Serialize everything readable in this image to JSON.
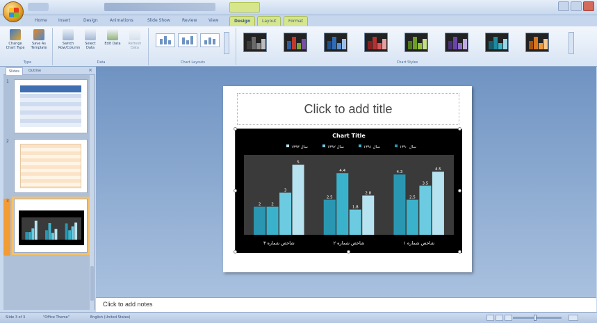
{
  "titlebar": {
    "window_title": "",
    "tools_title": ""
  },
  "ribbon": {
    "tabs": [
      {
        "label": "Home"
      },
      {
        "label": "Insert"
      },
      {
        "label": "Design"
      },
      {
        "label": "Animations"
      },
      {
        "label": "Slide Show"
      },
      {
        "label": "Review"
      },
      {
        "label": "View"
      },
      {
        "label": "Design",
        "active": true
      },
      {
        "label": "Layout"
      },
      {
        "label": "Format"
      }
    ],
    "type_group": {
      "label": "Type",
      "change_chart_type": "Change Chart Type",
      "save_as_template": "Save As Template"
    },
    "data_group": {
      "label": "Data",
      "switch_row_column": "Switch Row/Column",
      "select_data": "Select Data",
      "edit_data": "Edit Data",
      "refresh_data": "Refresh Data"
    },
    "layouts_group": {
      "label": "Chart Layouts"
    },
    "styles_group": {
      "label": "Chart Styles",
      "styles": [
        {
          "colors": [
            "#3c3c3c",
            "#6a6a6a",
            "#8e8e8e",
            "#bdbdbd"
          ]
        },
        {
          "colors": [
            "#2d5d9c",
            "#c0392b",
            "#7fa33a",
            "#7a4fa3"
          ]
        },
        {
          "colors": [
            "#1f4f8a",
            "#2f6cb8",
            "#5a8fd0",
            "#9ebde6"
          ]
        },
        {
          "colors": [
            "#8a1f1f",
            "#b83030",
            "#d05a5a",
            "#e69e9e"
          ]
        },
        {
          "colors": [
            "#4f7a1a",
            "#6f9e26",
            "#94c040",
            "#c2e08a"
          ]
        },
        {
          "colors": [
            "#4a2f7a",
            "#6a45a8",
            "#8e6fc6",
            "#c0abe2"
          ]
        },
        {
          "colors": [
            "#14606e",
            "#1f8aa0",
            "#3cb2c8",
            "#9ad8e4"
          ]
        },
        {
          "colors": [
            "#a35412",
            "#d8761e",
            "#f09a3e",
            "#f7c98c"
          ]
        }
      ]
    }
  },
  "leftpane": {
    "tab_slides": "Slides",
    "tab_outline": "Outline",
    "slide_numbers": [
      "1",
      "2",
      "3"
    ]
  },
  "slide": {
    "title_placeholder": "Click to add title",
    "chart_data": {
      "type": "bar",
      "title": "Chart Title",
      "categories": [
        "شاخص شماره ۱",
        "شاخص شماره ۲",
        "شاخص شماره ۳"
      ],
      "series": [
        {
          "name": "سال ۱۳۹۰",
          "values": [
            4.3,
            2.5,
            2.0
          ]
        },
        {
          "name": "سال ۱۳۹۱",
          "values": [
            2.5,
            4.4,
            2.0
          ]
        },
        {
          "name": "سال ۱۳۹۲",
          "values": [
            3.5,
            1.8,
            3.0
          ]
        },
        {
          "name": "سال ۱۳۹۳",
          "values": [
            4.5,
            2.8,
            5.0
          ]
        }
      ],
      "ylim": [
        0,
        5.5
      ],
      "legend": "top",
      "grid": false
    }
  },
  "notes": {
    "placeholder": "Click to add notes"
  },
  "status": {
    "slide_info": "Slide 3 of 3",
    "theme": "\"Office Theme\"",
    "language": "English (United States)"
  },
  "colors": {
    "series": [
      "#2a97b2",
      "#3bb2cc",
      "#6ccbe0",
      "#b7e3f0"
    ],
    "chart_bg": "#000000",
    "plot_bg": "#3a3a3a"
  }
}
